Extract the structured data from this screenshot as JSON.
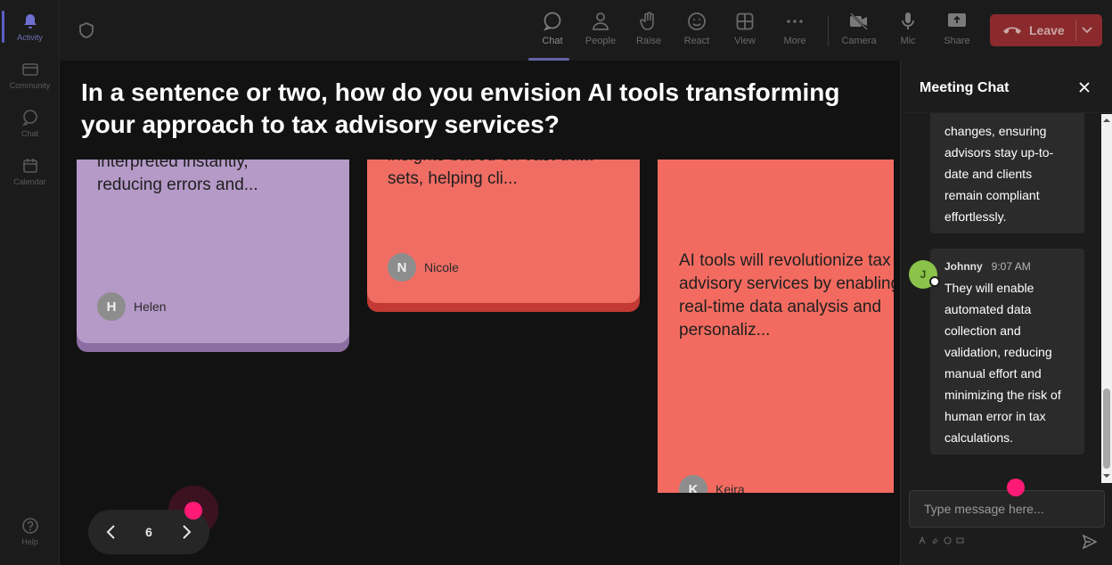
{
  "rail": {
    "items": [
      {
        "label": "Activity",
        "icon": "bell-icon",
        "active": true
      },
      {
        "label": "Community",
        "icon": "community-icon"
      },
      {
        "label": "Chat",
        "icon": "chat-icon"
      },
      {
        "label": "Calendar",
        "icon": "calendar-icon"
      }
    ],
    "help": {
      "label": "Help",
      "icon": "help-icon"
    }
  },
  "toolbar": {
    "buttons": [
      {
        "label": "Chat",
        "icon": "chat-bubble-icon",
        "active": true
      },
      {
        "label": "People",
        "icon": "people-icon"
      },
      {
        "label": "Raise",
        "icon": "hand-icon"
      },
      {
        "label": "React",
        "icon": "smile-icon"
      },
      {
        "label": "View",
        "icon": "grid-icon"
      },
      {
        "label": "More",
        "icon": "more-icon"
      },
      {
        "label": "Camera",
        "icon": "camera-off-icon"
      },
      {
        "label": "Mic",
        "icon": "mic-icon"
      },
      {
        "label": "Share",
        "icon": "share-icon"
      }
    ],
    "leave_label": "Leave"
  },
  "board": {
    "question": "In a sentence or two, how do you envision AI tools transforming your approach to tax advisory services?",
    "cards": [
      {
        "text_top": "interpreted instantly,",
        "text": "reducing errors and...",
        "author": "Helen",
        "initial": "H",
        "color": "#b59ac8",
        "shadow": "#8d6ea3"
      },
      {
        "text_top": "insights based on vast data",
        "text": "sets, helping cli...",
        "author": "Nicole",
        "initial": "N",
        "color": "#f06d64",
        "shadow": "#c23a33"
      },
      {
        "text": "AI tools will revolutionize tax advisory services by enabling real-time data analysis and personaliz...",
        "author": "Keira",
        "initial": "K",
        "color": "#f36b60"
      }
    ],
    "page": "6"
  },
  "chat": {
    "title": "Meeting Chat",
    "messages": [
      {
        "text": "changes, ensuring advisors stay up-to-date and clients remain compliant effortlessly."
      },
      {
        "sender": "Johnny",
        "initial": "J",
        "time": "9:07 AM",
        "text": "They will enable automated data collection and validation, reducing manual effort and minimizing the risk of human error in tax calculations."
      }
    ],
    "input_placeholder": "Type message here..."
  },
  "colors": {
    "accent": "#6264a7",
    "leave": "#c4314b",
    "marker": "#ff1a75",
    "avatar_j": "#8bc34a"
  }
}
